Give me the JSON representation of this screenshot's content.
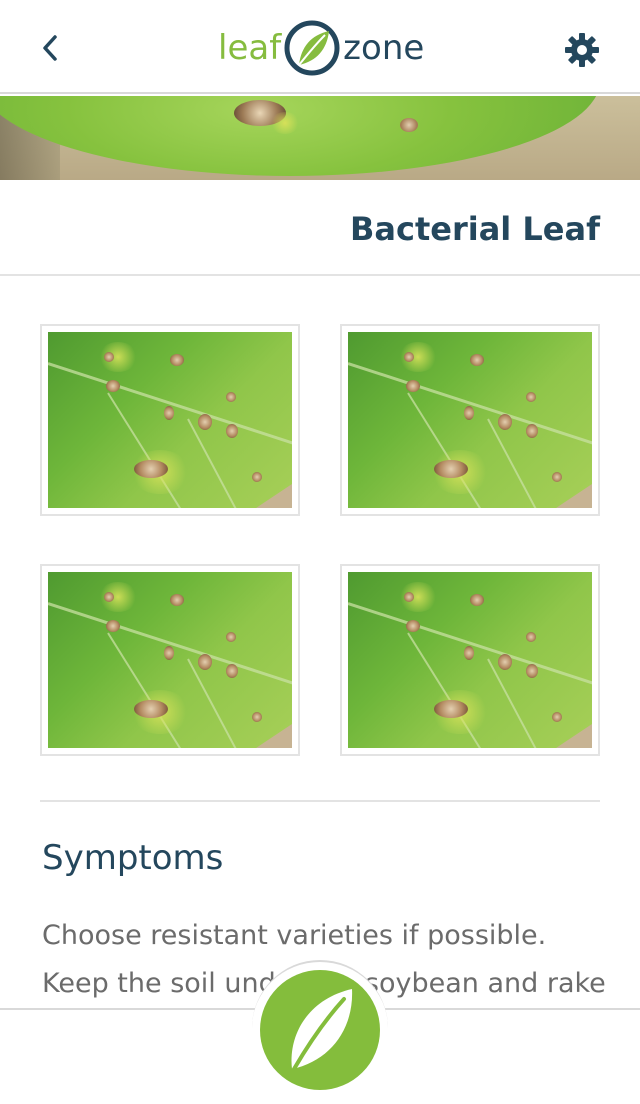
{
  "header": {
    "back_icon": "chevron-left-icon",
    "logo_left": "leaf",
    "logo_right": "zone",
    "settings_icon": "gear-icon",
    "brand_green": "#86bc3f",
    "brand_navy": "#24475d"
  },
  "page": {
    "title": "Bacterial Leaf"
  },
  "gallery": {
    "images": [
      {
        "alt_icon": "leaf-photo"
      },
      {
        "alt_icon": "leaf-photo"
      },
      {
        "alt_icon": "leaf-photo"
      },
      {
        "alt_icon": "leaf-photo"
      }
    ]
  },
  "content": {
    "section_heading": "Symptoms",
    "body": "Choose resistant varieties if possible. Keep the soil under the soybean and rake up"
  },
  "bottom_nav": {
    "fab_icon": "leaf-icon"
  }
}
